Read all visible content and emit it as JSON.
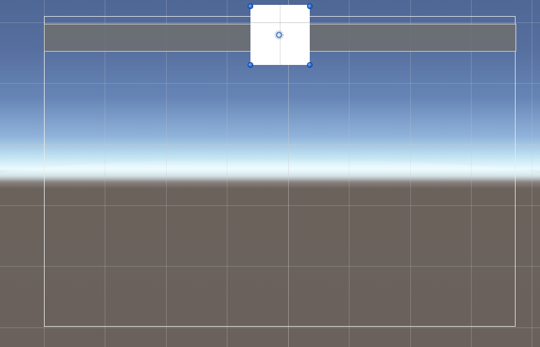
{
  "scene": {
    "colors": {
      "sky_top": "#4f6795",
      "horizon": "#eafaff",
      "ground": "#6a615c",
      "selection_handle": "#1c63d6",
      "canvas_outline": "#ebebeb",
      "panel_fill": "#6e6e6e",
      "image_fill": "#ffffff"
    },
    "icons": {
      "pivot": "rect-transform-pivot-icon",
      "handle": "resize-handle-dot"
    }
  }
}
